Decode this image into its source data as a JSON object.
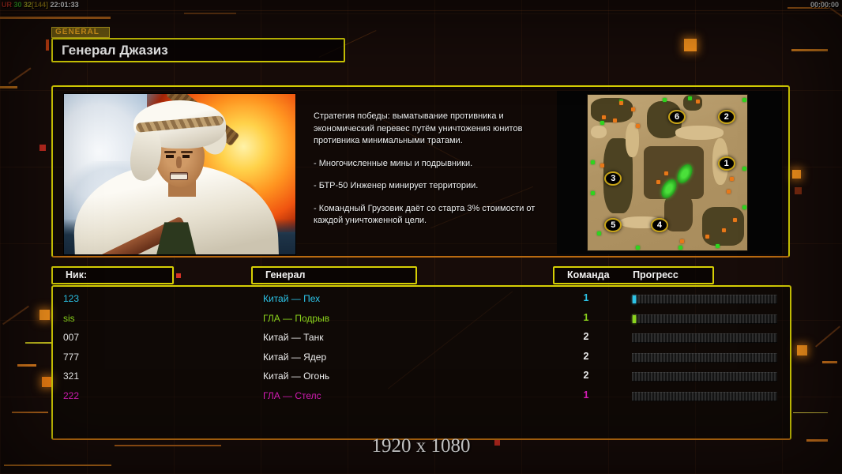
{
  "hud": {
    "debug_segments": [
      {
        "text": "UR ",
        "color": "#cf3526"
      },
      {
        "text": "30 ",
        "color": "#3fbf2a"
      },
      {
        "text": "32",
        "color": "#c3c32a"
      },
      {
        "text": "[144] ",
        "color": "#9a7d14"
      },
      {
        "text": "22:01:33",
        "color": "#f2f2f2"
      }
    ],
    "match_timer": "00:00:00"
  },
  "header": {
    "tab_label": "GENERAL",
    "title": "Генерал Джазиз"
  },
  "briefing": {
    "paragraphs": [
      "Стратегия победы: выматывание противника и экономический перевес путём уничтожения юнитов противника минимальными тратами.",
      "- Многочисленные мины и подрывники.",
      "- БТР-50 Инженер минирует территории.",
      "- Командный Грузовик даёт со старта 3% стоимости от каждой уничтоженной цели."
    ]
  },
  "minimap": {
    "markers": [
      {
        "number": "1",
        "x": 87,
        "y": 44
      },
      {
        "number": "2",
        "x": 87,
        "y": 14
      },
      {
        "number": "3",
        "x": 16,
        "y": 54
      },
      {
        "number": "4",
        "x": 45,
        "y": 84
      },
      {
        "number": "5",
        "x": 16,
        "y": 84
      },
      {
        "number": "6",
        "x": 56,
        "y": 14
      }
    ]
  },
  "table": {
    "headers": {
      "nick": "Ник:",
      "general": "Генерал",
      "team": "Команда",
      "progress": "Прогресс"
    },
    "rows": [
      {
        "nick": "123",
        "general": "Китай — Пех",
        "team": "1",
        "color": "#2cc4e8",
        "progress": 2
      },
      {
        "nick": "sis",
        "general": "ГЛА — Подрыв",
        "team": "1",
        "color": "#8bd41c",
        "progress": 2
      },
      {
        "nick": "007",
        "general": "Китай — Танк",
        "team": "2",
        "color": "#ececec",
        "progress": 0
      },
      {
        "nick": "777",
        "general": "Китай — Ядер",
        "team": "2",
        "color": "#ececec",
        "progress": 0
      },
      {
        "nick": "321",
        "general": "Китай — Огонь",
        "team": "2",
        "color": "#ececec",
        "progress": 0
      },
      {
        "nick": "222",
        "general": "ГЛА — Стелс",
        "team": "1",
        "color": "#d81cb8",
        "progress": 0
      }
    ]
  },
  "footer": {
    "resolution": "1920 x 1080"
  },
  "colors": {
    "panel_border": "#d6cf04",
    "accent_orange": "#f6921c"
  }
}
